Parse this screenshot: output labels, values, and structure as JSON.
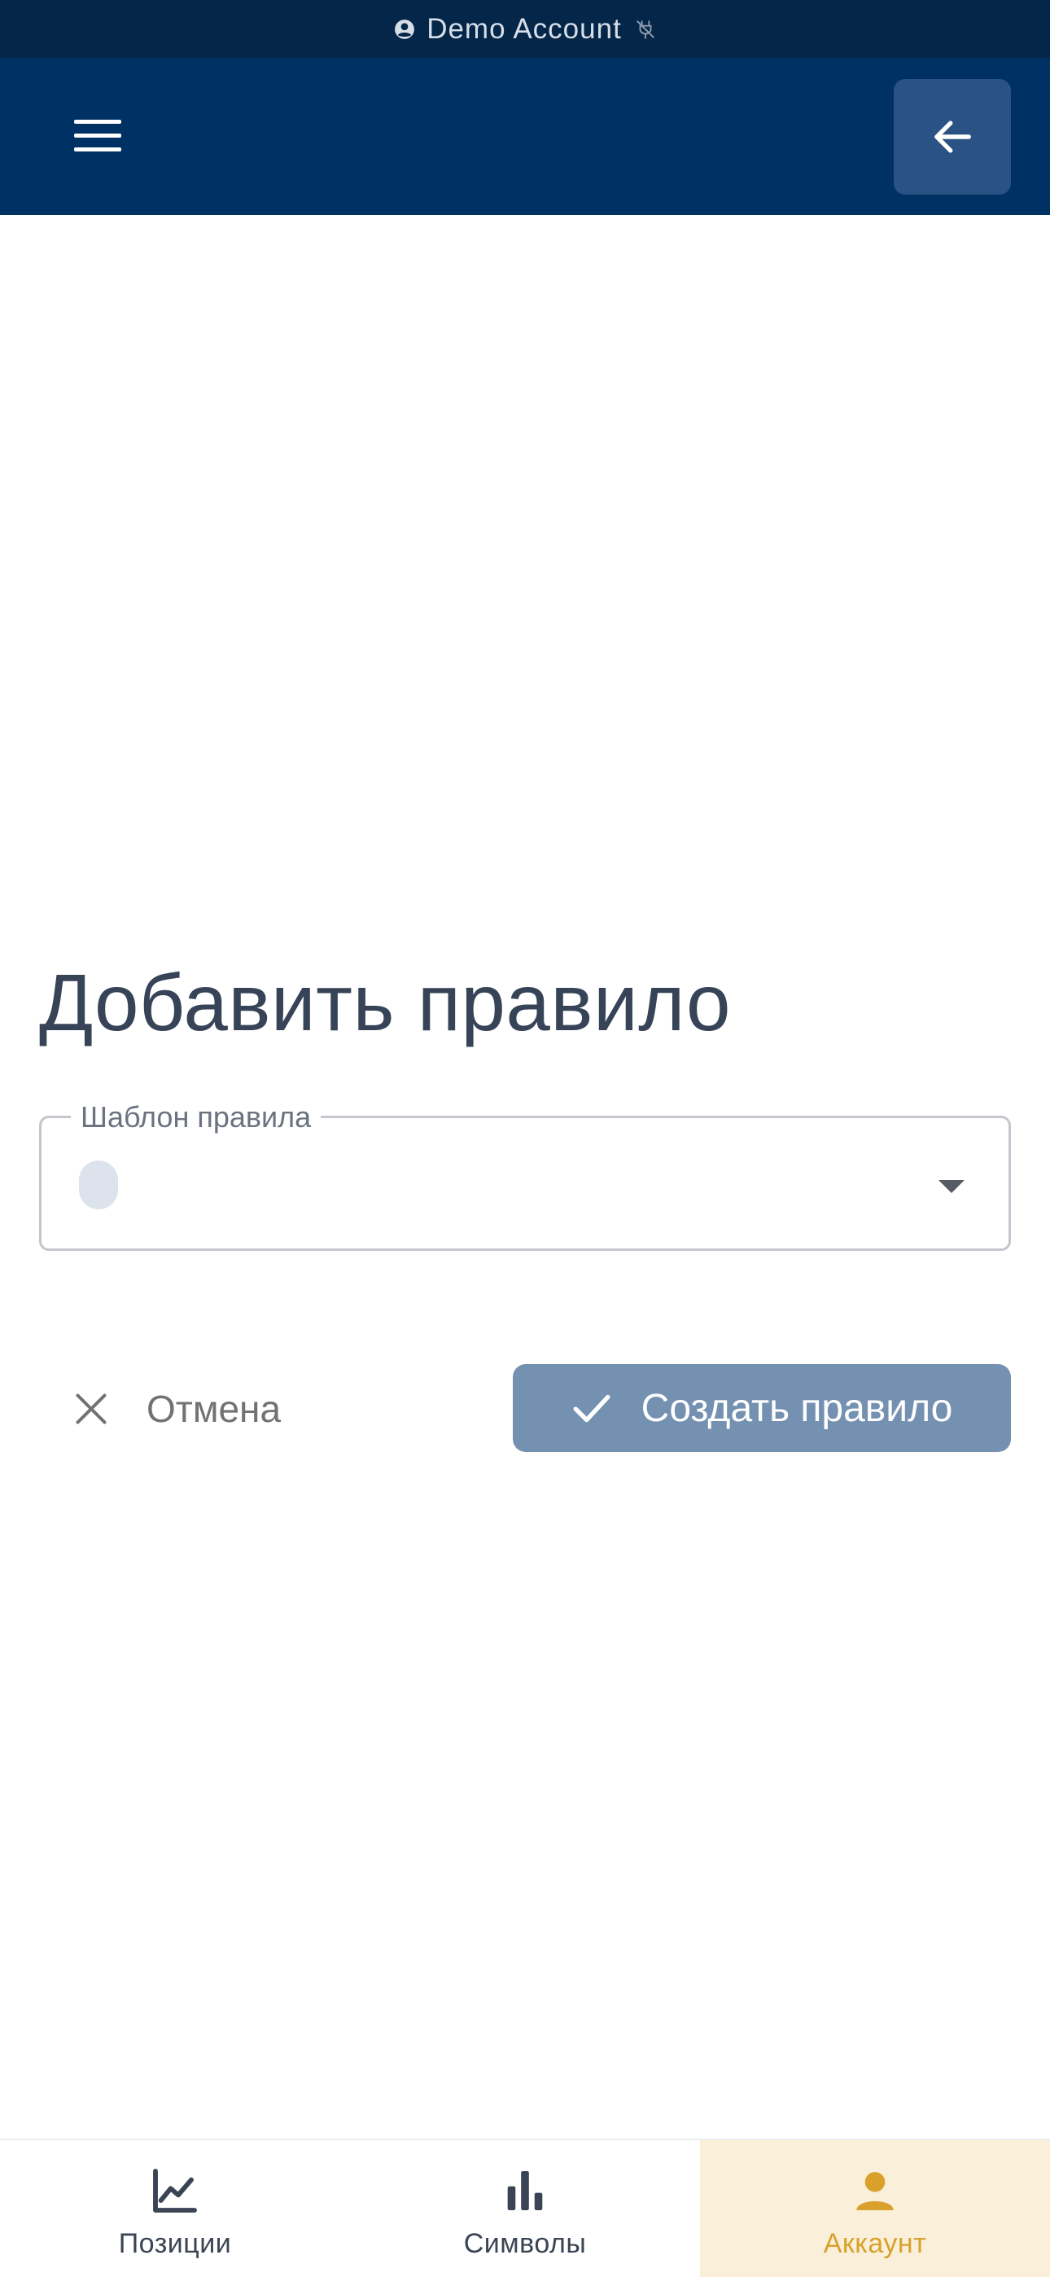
{
  "status_bar": {
    "account_label": "Demo Account",
    "account_icon": "account-circle-icon",
    "connection_icon": "disconnected-icon"
  },
  "app_bar": {
    "menu_icon": "hamburger-menu-icon",
    "back_icon": "arrow-left-icon"
  },
  "main": {
    "title": "Добавить правило",
    "template_select": {
      "label": "Шаблон правила",
      "value": ""
    },
    "cancel_label": "Отмена",
    "create_label": "Создать правило"
  },
  "bottom_nav": {
    "items": [
      {
        "label": "Позиции",
        "icon": "line-chart-icon",
        "active": false
      },
      {
        "label": "Символы",
        "icon": "bar-chart-icon",
        "active": false
      },
      {
        "label": "Аккаунт",
        "icon": "person-icon",
        "active": true
      }
    ]
  },
  "colors": {
    "status_bar_bg": "#042649",
    "app_bar_bg": "#003164",
    "back_button_bg": "#2a5284",
    "create_button_bg": "#7491b1",
    "active_nav_bg": "#faf0da",
    "active_nav_accent": "#d9a12b",
    "title_text": "#374458"
  }
}
